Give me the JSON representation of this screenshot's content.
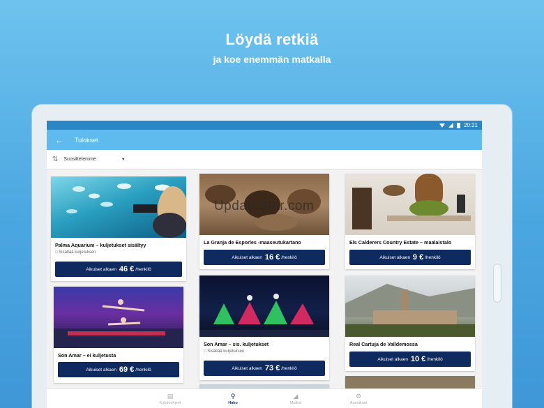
{
  "hero": {
    "title": "Löydä retkiä",
    "subtitle": "ja koe enemmän matkalla"
  },
  "statusbar": {
    "time": "20:21"
  },
  "appbar": {
    "title": "Tulokset"
  },
  "sort": {
    "label": "Suosittelemme"
  },
  "cards": [
    {
      "title": "Palma Aquarium – kuljetukset sisältyy",
      "note": "Sisältää kuljetuksen",
      "btn_prefix": "Aikuiset alkaen",
      "price": "46 €",
      "btn_suffix": "/henkilö"
    },
    {
      "title": "La Granja de Esporles -maaseutukartano",
      "note": "",
      "btn_prefix": "Aikuiset alkaen",
      "price": "16 €",
      "btn_suffix": "/henkilö"
    },
    {
      "title": "Els Calderers Country Estate – maalaistalo",
      "note": "",
      "btn_prefix": "Aikuiset alkaen",
      "price": "9 €",
      "btn_suffix": "/henkilö"
    },
    {
      "title": "Son Amar – ei kuljetusta",
      "note": "",
      "btn_prefix": "Aikuiset alkaen",
      "price": "69 €",
      "btn_suffix": "/henkilö"
    },
    {
      "title": "Son Amar – sis. kuljetukset",
      "note": "Sisältää kuljetuksen",
      "btn_prefix": "Aikuiset alkaen",
      "price": "73 €",
      "btn_suffix": "/henkilö"
    },
    {
      "title": "Real Cartuja de Valldemossa",
      "note": "",
      "btn_prefix": "Aikuiset alkaen",
      "price": "10 €",
      "btn_suffix": "/henkilö"
    }
  ],
  "nav": [
    {
      "label": "Kohdeohjeet",
      "icon": "book-icon"
    },
    {
      "label": "Haku",
      "icon": "search-icon"
    },
    {
      "label": "Matkat",
      "icon": "tag-icon"
    },
    {
      "label": "Asetukset",
      "icon": "gear-icon"
    }
  ],
  "watermark": "UpdateStar.com"
}
